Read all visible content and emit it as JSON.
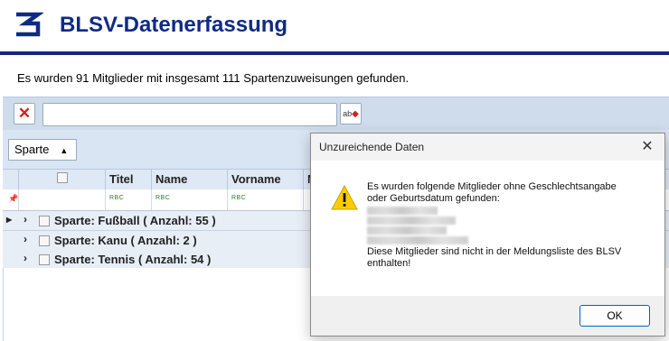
{
  "header": {
    "logo_icon": "blsv-logo-icon",
    "title": "BLSV-Datenerfassung",
    "rule_color": "#14248a",
    "title_color": "#102a84"
  },
  "summary": "Es wurden 91 Mitglieder mit insgesamt 111 Spartenzuweisungen gefunden.",
  "toolbar": {
    "clear_icon": "close-icon",
    "search_value": "",
    "abc_button_label": "ab"
  },
  "groupbar": {
    "group_label": "Sparte",
    "sort_icon": "sort-ascending-icon"
  },
  "columns": [
    "Titel",
    "Name",
    "Vorname",
    "N"
  ],
  "filter_abc_label": "RBC",
  "groups": [
    {
      "label": "Sparte: Fußball  ( Anzahl: 55 )"
    },
    {
      "label": "Sparte: Kanu  ( Anzahl: 2 )"
    },
    {
      "label": "Sparte: Tennis  ( Anzahl: 54 )"
    }
  ],
  "dialog": {
    "title": "Unzureichende Daten",
    "close_icon": "close-icon",
    "warning_icon": "warning-icon",
    "line1": "Es wurden folgende Mitglieder ohne Geschlechtsangabe",
    "line2": "oder Geburtsdatum gefunden:",
    "line3": "Diese Mitglieder sind nicht in der Meldungsliste des BLSV",
    "line4": "enthalten!",
    "ok_label": "OK"
  }
}
